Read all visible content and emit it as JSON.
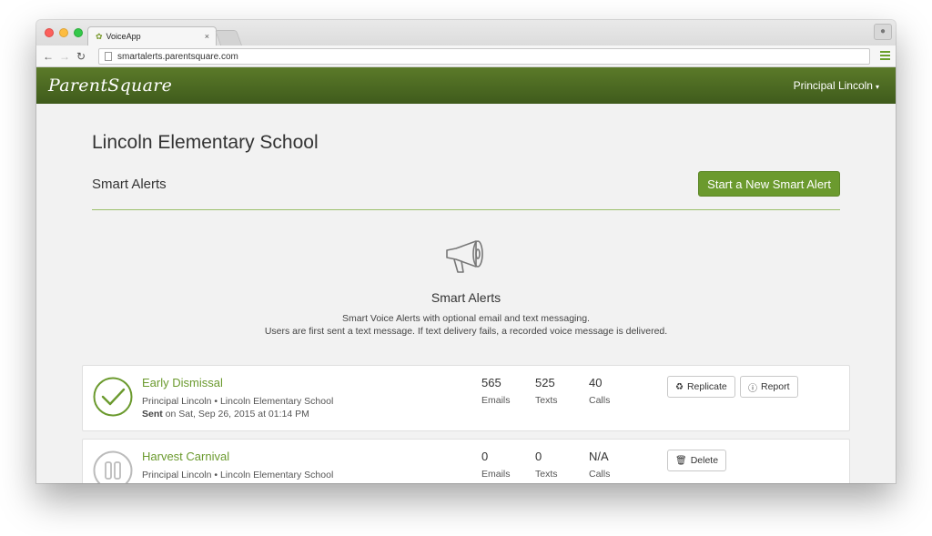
{
  "browser": {
    "tab_title": "VoiceApp",
    "tab_close": "×",
    "url": "smartalerts.parentsquare.com"
  },
  "header": {
    "logo": "ParentSquare",
    "user_name": "Principal Lincoln",
    "user_caret": "▾"
  },
  "page": {
    "school_title": "Lincoln Elementary School",
    "section_title": "Smart Alerts",
    "new_alert_button": "Start a New Smart Alert"
  },
  "empty_state": {
    "title": "Smart Alerts",
    "line1": "Smart Voice Alerts with optional email and text messaging.",
    "line2": "Users are first sent a text message. If text delivery fails, a recorded voice message is delivered."
  },
  "alerts": [
    {
      "name": "Early Dismissal",
      "meta": "Principal Lincoln • Lincoln Elementary School",
      "sent_label": "Sent",
      "sent_rest": " on Sat, Sep 26, 2015 at 01:14 PM",
      "status": "sent",
      "emails": "565",
      "texts": "525",
      "calls": "40",
      "emails_label": "Emails",
      "texts_label": "Texts",
      "calls_label": "Calls",
      "buttons": [
        "Replicate",
        "Report"
      ]
    },
    {
      "name": "Harvest Carnival",
      "meta": "Principal Lincoln • Lincoln Elementary School",
      "status": "paused",
      "emails": "0",
      "texts": "0",
      "calls": "N/A",
      "emails_label": "Emails",
      "texts_label": "Texts",
      "calls_label": "Calls",
      "buttons": [
        "Delete"
      ]
    }
  ],
  "colors": {
    "brand_green": "#6b9a2e",
    "header_green": "#4a6a22"
  },
  "icons": {
    "replicate": "recycle-icon",
    "report": "info-icon",
    "delete": "trash-icon",
    "hero": "megaphone-icon"
  }
}
